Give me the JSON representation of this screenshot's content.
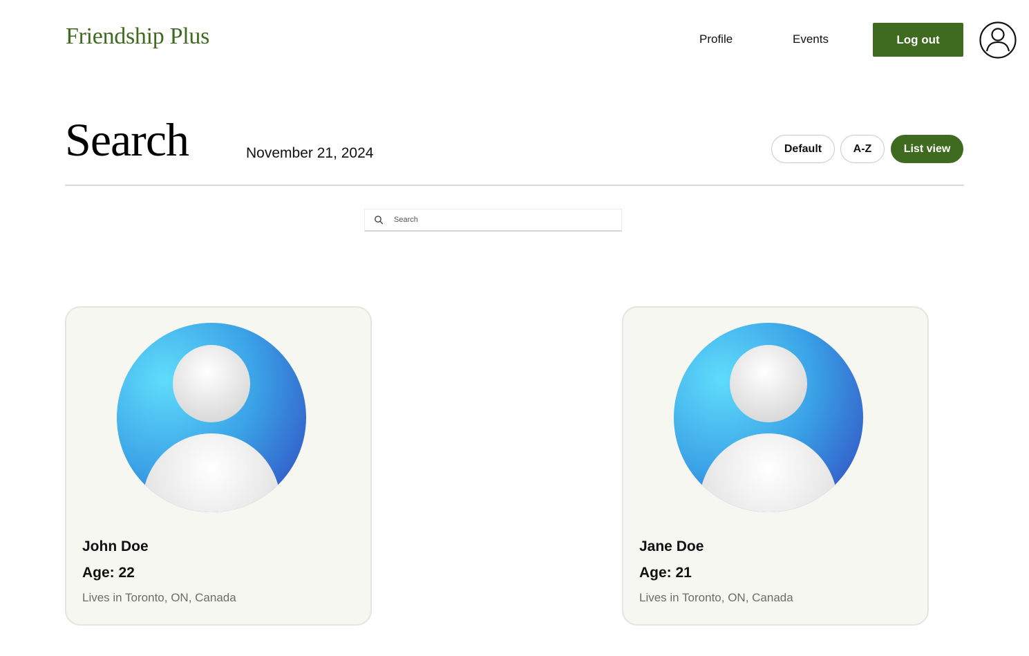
{
  "header": {
    "brand": "Friendship Plus",
    "nav": {
      "profile": "Profile",
      "events": "Events"
    },
    "logout_label": "Log out",
    "account_icon": "user-circle-icon",
    "accent_color": "#3e6b1f"
  },
  "page": {
    "title": "Search",
    "date_month": "November",
    "date_rest": " 21, 2024"
  },
  "sort_options": {
    "default_label": "Default",
    "az_label": "A-Z",
    "list_view_label": "List view",
    "active": "List view"
  },
  "search": {
    "placeholder": "Search",
    "icon": "search-icon"
  },
  "profiles": [
    {
      "name": "John Doe",
      "age": "Age: 22",
      "location": "Lives in Toronto, ON, Canada",
      "avatar_icon": "default-avatar-icon"
    },
    {
      "name": "Jane Doe",
      "age": "Age: 21",
      "location": "Lives in Toronto, ON, Canada",
      "avatar_icon": "default-avatar-icon"
    }
  ]
}
